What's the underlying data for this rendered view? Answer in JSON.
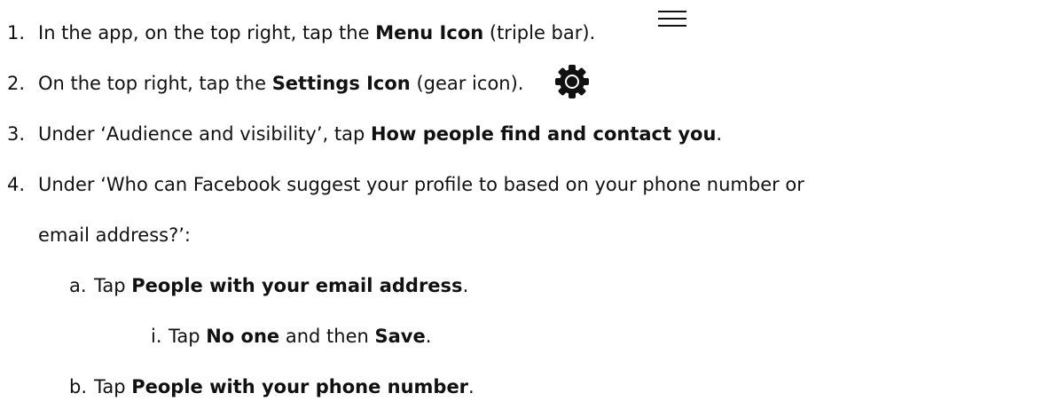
{
  "steps": [
    {
      "marker": "1.",
      "pre": "In the app, on the top right, tap the ",
      "bold": "Menu Icon",
      "post": " (triple bar).",
      "icon": "menu-icon"
    },
    {
      "marker": "2.",
      "pre": "On the top right, tap the ",
      "bold": "Settings Icon",
      "post": " (gear icon).",
      "icon": "gear-icon"
    },
    {
      "marker": "3.",
      "pre": "Under ‘Audience and visibility’, tap ",
      "bold": "How people find and contact you",
      "post": "."
    },
    {
      "marker": "4.",
      "line1": "Under ‘Who can Facebook suggest your profile to based on your phone number or",
      "line2": "email address?’:"
    }
  ],
  "substeps": [
    {
      "marker": "a.",
      "pre": "Tap ",
      "bold": "People with your email address",
      "post": "."
    },
    {
      "marker": "i.",
      "pre": "Tap ",
      "bold1": "No one",
      "mid": " and then ",
      "bold2": "Save",
      "post": "."
    },
    {
      "marker": "b.",
      "pre": "Tap ",
      "bold": "People with your phone number",
      "post": "."
    }
  ],
  "colors": {
    "text": "#111111",
    "background": "#ffffff"
  }
}
